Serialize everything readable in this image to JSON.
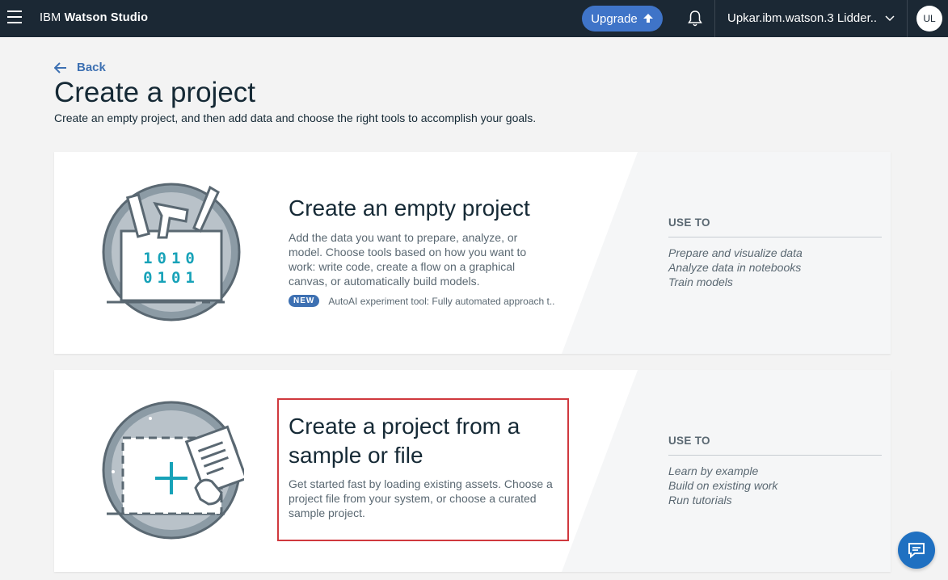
{
  "header": {
    "brand_prefix": "IBM",
    "brand_name": "Watson Studio",
    "upgrade_label": "Upgrade",
    "account_name": "Upkar.ibm.watson.3 Lidder...",
    "avatar_initials": "UL"
  },
  "page": {
    "back_label": "Back",
    "title": "Create a project",
    "subtitle": "Create an empty project, and then add data and choose the right tools to accomplish your goals."
  },
  "cards": [
    {
      "title": "Create an empty project",
      "description": "Add the data you want to prepare, analyze, or model. Choose tools based on how you want to work: write code, create a flow on a graphical canvas, or automatically build models.",
      "badge": "NEW",
      "badge_text": "AutoAI experiment tool: Fully automated approach t..",
      "illustration_line1": "1010",
      "illustration_line2": "0101",
      "use_to_title": "USE TO",
      "use_to_items": [
        "Prepare and visualize data",
        "Analyze data in notebooks",
        "Train models"
      ]
    },
    {
      "title": "Create a project from a sample or file",
      "description": "Get started fast by loading existing assets. Choose a project file from your system, or choose a curated sample project.",
      "use_to_title": "USE TO",
      "use_to_items": [
        "Learn by example",
        "Build on existing work",
        "Run tutorials"
      ]
    }
  ],
  "colors": {
    "topbar": "#1b2834",
    "accent": "#3d70b2",
    "upgrade": "#3f74c8",
    "highlight": "#d0393e",
    "chat": "#1f70c1"
  }
}
